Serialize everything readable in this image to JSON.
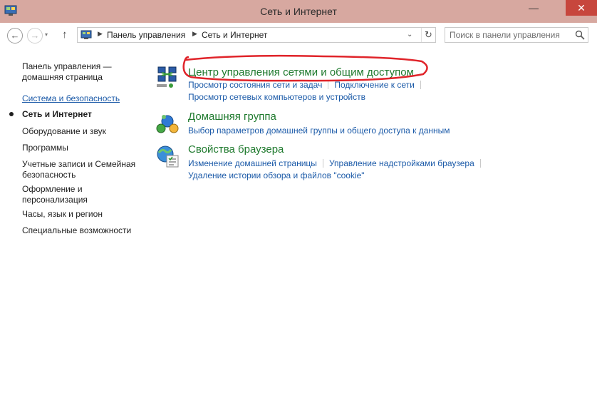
{
  "window": {
    "title": "Сеть и Интернет",
    "minimize_glyph": "—",
    "close_glyph": "✕"
  },
  "nav": {
    "back_glyph": "←",
    "forward_glyph": "→",
    "forward_dropdown_glyph": "▾",
    "up_glyph": "↑",
    "breadcrumb": [
      "Панель управления",
      "Сеть и Интернет"
    ],
    "crumb_separator": "▶",
    "address_dropdown_glyph": "⌄",
    "refresh_glyph": "↻",
    "search_placeholder": "Поиск в панели управления"
  },
  "sidebar": {
    "items": [
      {
        "label": "Панель управления — домашняя страница",
        "kind": "normal"
      },
      {
        "label": "Система и безопасность",
        "kind": "link"
      },
      {
        "label": "Сеть и Интернет",
        "kind": "current"
      },
      {
        "label": "Оборудование и звук",
        "kind": "normal"
      },
      {
        "label": "Программы",
        "kind": "normal"
      },
      {
        "label": "Учетные записи и Семейная безопасность",
        "kind": "normal"
      },
      {
        "label": "Оформление и персонализация",
        "kind": "normal"
      },
      {
        "label": "Часы, язык и регион",
        "kind": "normal"
      },
      {
        "label": "Специальные возможности",
        "kind": "normal"
      }
    ]
  },
  "categories": [
    {
      "icon": "network-sharing-center-icon",
      "title": "Центр управления сетями и общим доступом",
      "tasks": [
        [
          "Просмотр состояния сети и задач",
          "Подключение к сети"
        ],
        [
          "Просмотр сетевых компьютеров и устройств"
        ]
      ]
    },
    {
      "icon": "homegroup-icon",
      "title": "Домашняя группа",
      "tasks": [
        [
          "Выбор параметров домашней группы и общего доступа к данным"
        ]
      ]
    },
    {
      "icon": "internet-options-icon",
      "title": "Свойства браузера",
      "tasks": [
        [
          "Изменение домашней страницы",
          "Управление надстройками браузера"
        ],
        [
          "Удаление истории обзора и файлов \"cookie\""
        ]
      ]
    }
  ],
  "colors": {
    "titlebar": "#d7a8a0",
    "close": "#c7463d",
    "link": "#1b5aa8",
    "category_title": "#1f7a2e",
    "annotation": "#e0242a"
  }
}
